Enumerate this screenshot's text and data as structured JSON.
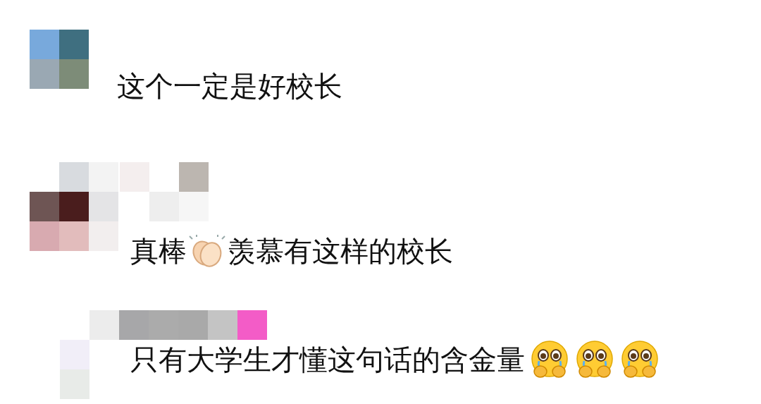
{
  "comments": [
    {
      "segments": [
        {
          "kind": "text",
          "text": "这个一定是好校长"
        }
      ]
    },
    {
      "segments": [
        {
          "kind": "text",
          "text": "真棒"
        },
        {
          "kind": "clap"
        },
        {
          "kind": "text",
          "text": "羡慕有这样的校长"
        }
      ]
    },
    {
      "segments": [
        {
          "kind": "text",
          "text": "只有大学生才懂这句话的含金量"
        },
        {
          "kind": "teary"
        },
        {
          "kind": "teary"
        },
        {
          "kind": "teary"
        }
      ]
    }
  ]
}
